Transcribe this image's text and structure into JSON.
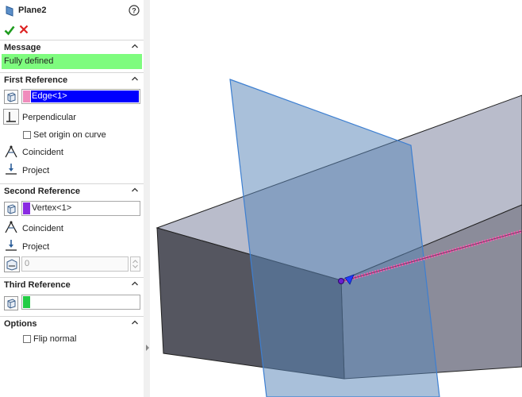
{
  "panel": {
    "title": "Plane2",
    "icons": {
      "feature": "plane-feature-icon",
      "help": "help-icon",
      "ok": "ok-checkmark-icon",
      "cancel": "cancel-x-icon"
    },
    "message": {
      "header": "Message",
      "text": "Fully defined",
      "bg_color": "#7efc7e"
    },
    "first_reference": {
      "header": "First Reference",
      "selection": "Edge<1>",
      "swatch_color": "#f08cbc",
      "highlight_color": "#0000ff",
      "options": {
        "perpendicular": "Perpendicular",
        "set_origin": "Set origin on curve",
        "coincident": "Coincident",
        "project": "Project"
      }
    },
    "second_reference": {
      "header": "Second Reference",
      "selection": "Vertex<1>",
      "swatch_color": "#8a2be2",
      "options": {
        "coincident": "Coincident",
        "project": "Project"
      },
      "distance_value": "0"
    },
    "third_reference": {
      "header": "Third Reference",
      "selection": "",
      "swatch_color": "#22cc44"
    },
    "options": {
      "header": "Options",
      "flip_normal": "Flip normal"
    }
  }
}
